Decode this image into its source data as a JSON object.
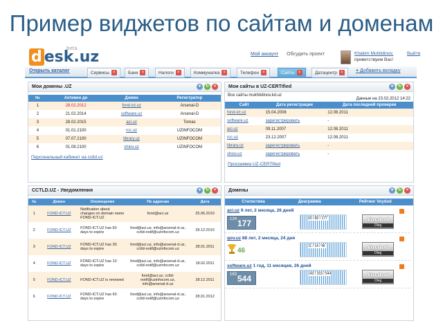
{
  "slide": {
    "title": "Пример виджетов по сайтам и доменам"
  },
  "header": {
    "logo": "desk.uz",
    "logo_beta": "beta",
    "links": [
      "Мой аккаунт",
      "Обсудить проект"
    ],
    "nav_link_current": "Обсудить проект",
    "user_name": "Khakim Muhitdinov,",
    "user_greeting": "приветствуем Вас!",
    "logout": "Выйти"
  },
  "tabbar": {
    "open_catalog": "Открыть каталог",
    "tabs": [
      "Сервисы",
      "Банк",
      "Налоги",
      "Коммуналка",
      "Телефон",
      "Сайты",
      "Датацентр"
    ],
    "active_tab": "Сайты",
    "add_tab": "Добавить вкладку",
    "close_symbol": "×"
  },
  "colors": {
    "accent": "#4a8ecb",
    "row_alt": "#fdf0dc",
    "active_tab": "#5aa8d6",
    "red": "#cc2222"
  },
  "domains_widget": {
    "title": "Мои домены .UZ",
    "columns": [
      "№",
      "Активен до",
      "Домен",
      "Регистратор"
    ],
    "rows": [
      {
        "n": "1",
        "active": "28.02.2012",
        "domain": "fond-ict.uz",
        "registrar": "Arsenal-D"
      },
      {
        "n": "2",
        "active": "21.02.2014",
        "domain": "software.uz",
        "registrar": "Arsenal-D"
      },
      {
        "n": "3",
        "active": "28.02.2015",
        "domain": "aci.uz",
        "registrar": "Tomas"
      },
      {
        "n": "4",
        "active": "01.01.2100",
        "domain": "rcc.uz",
        "registrar": "UZINFOCOM"
      },
      {
        "n": "5",
        "active": "07.07.2100",
        "domain": "library.uz",
        "registrar": "UZINFOCOM"
      },
      {
        "n": "6",
        "active": "01.08.2100",
        "domain": "shiov.uz",
        "registrar": "UZINFOCOM"
      }
    ],
    "footer_link": "Персональный кабинет на cctld.uz"
  },
  "certified_widget": {
    "title": "Мои сайты в UZ-CERTified",
    "subtitle": "Все сайты mukhitdinov.kd.uz",
    "updated": "Данные на 23.02.2012 14:22",
    "columns": [
      "Сайт",
      "Дата регистрации",
      "Дата последней проверки"
    ],
    "rows": [
      {
        "site": "fond-ict.uz",
        "reg": "15.04.2008",
        "check": "12.08.2011"
      },
      {
        "site": "software.uz",
        "reg": "зарегистрировать",
        "check": "-"
      },
      {
        "site": "aci.uz",
        "reg": "09.11.2007",
        "check": "12.08.2011"
      },
      {
        "site": "rcc.uz",
        "reg": "23.12.2007",
        "check": "12.08.2011"
      },
      {
        "site": "library.uz",
        "reg": "зарегистрировать",
        "check": "-"
      },
      {
        "site": "shiov.uz",
        "reg": "зарегистрировать",
        "check": "-"
      }
    ],
    "footer_link": "Программа UZ-CERTified"
  },
  "notices_widget": {
    "title": "CCTLD.UZ - Уведомления",
    "columns": [
      "№",
      "Домен",
      "Оповещение",
      "По адресам",
      "Дата"
    ],
    "rows": [
      {
        "n": "1",
        "domain": "FOND-ICT.UZ",
        "note": "Notification about changes on domain name FOND-ICT.UZ",
        "addr": "fond@aci.uz",
        "date": "25.06.2010"
      },
      {
        "n": "2",
        "domain": "FOND-ICT.UZ",
        "note": "FOND-ICT.UZ has 60 days to expire",
        "addr": "fond@aci.uz, info@arsenal-d.uz, cctld-notif@uzinfocom.uz",
        "date": "28.12.2010"
      },
      {
        "n": "3",
        "domain": "FOND-ICT.UZ",
        "note": "FOND-ICT.UZ has 30 days to expire",
        "addr": "fond@aci.uz, info@arsenal-d.uz, cctld-notif@uzinfocom.uz",
        "date": "28.01.2011"
      },
      {
        "n": "4",
        "domain": "FOND-ICT.UZ",
        "note": "FOND-ICT.UZ has 10 days to expire",
        "addr": "fond@aci.uz, info@arsenal-d.uz, cctld-notif@uzinfocom.uz",
        "date": "18.02.2011"
      },
      {
        "n": "5",
        "domain": "FOND-ICT.UZ",
        "note": "FOND-ICT.UZ is renewed",
        "addr": "fond@aci.uz, cctld-notif@uzinfocom.uz, info@arsenal-d.uz",
        "date": "28.12.2011"
      },
      {
        "n": "6",
        "domain": "FOND-ICT.UZ",
        "note": "FOND-ICT.UZ has 60 days to expire",
        "addr": "fond@aci.uz, info@arsenal-d.uz, cctld-notif@uzinfocom.uz",
        "date": "28.01.2012"
      }
    ]
  },
  "stats_widget": {
    "title": "Домены",
    "columns": [
      "Статистика",
      "Диаграмма",
      "Рейтинг Voydod"
    ],
    "rows": [
      {
        "domain": "aci.uz",
        "age": "9 лет, 2 месяца, 26 дней",
        "small": "124",
        "big": "177",
        "spark": "60 / 80 / 177",
        "badge": "Voydod",
        "badge_sub": "Oleg"
      },
      {
        "domain": "qov.uz",
        "age": "88 лет, 2 месяца, 24 дня",
        "small": "",
        "big": "46",
        "spark": "11 / 14 / 46",
        "badge": "Voydod",
        "badge_sub": "Oleg"
      },
      {
        "domain": "software.uz",
        "age": "1 год, 11 месяцев, 26 дней",
        "small": "163",
        "big": "544",
        "spark": "143 / 163 / 544",
        "badge": "Voydod",
        "badge_sub": "Oleg"
      }
    ]
  }
}
